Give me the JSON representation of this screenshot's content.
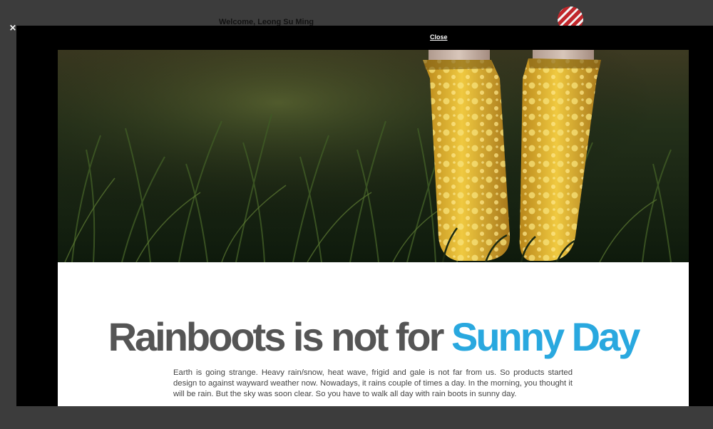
{
  "background_page": {
    "welcome_text": "Welcome, Leong Su Ming"
  },
  "overlay": {
    "close_icon": "close-x-icon",
    "close_glyph": "×"
  },
  "modal": {
    "close_label": "Close",
    "article": {
      "image": "grass-and-yellow-polka-dot-rainboots",
      "headline": {
        "main": "Rainboots is not for ",
        "accent": "Sunny Day"
      },
      "body": "Earth is going strange. Heavy rain/snow, heat wave, frigid and gale is not far from us. So products started design to against wayward weather now. Nowadays, it rains couple of times a day. In the morning, you thought it will be rain. But the sky was soon clear. So you have to walk all day with rain boots in sunny day."
    }
  },
  "colors": {
    "overlay": "#3c3c3c",
    "modal": "#000000",
    "headline_main": "#555555",
    "headline_accent": "#29a8df",
    "boot_yellow": "#e6b826"
  }
}
